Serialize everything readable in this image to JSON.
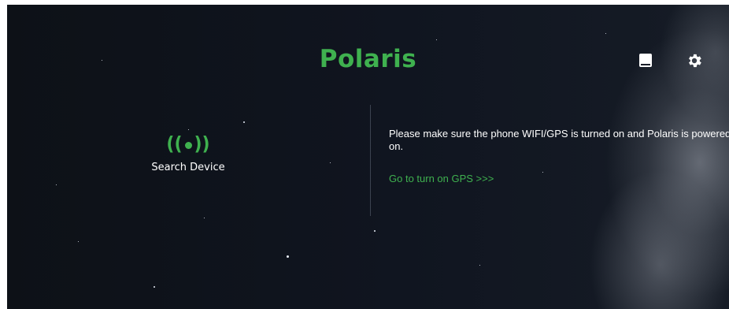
{
  "header": {
    "title": "Polaris",
    "manual_icon": "book-icon",
    "settings_icon": "gear-icon"
  },
  "search": {
    "icon": "signal-broadcast-icon",
    "label": "Search Device"
  },
  "info": {
    "message": "Please make sure the phone WIFI/GPS is turned on and Polaris is powered on.",
    "gps_link": "Go to turn on GPS >>>"
  },
  "colors": {
    "accent": "#3fb14f",
    "background": "#101520",
    "text": "#ffffff"
  }
}
